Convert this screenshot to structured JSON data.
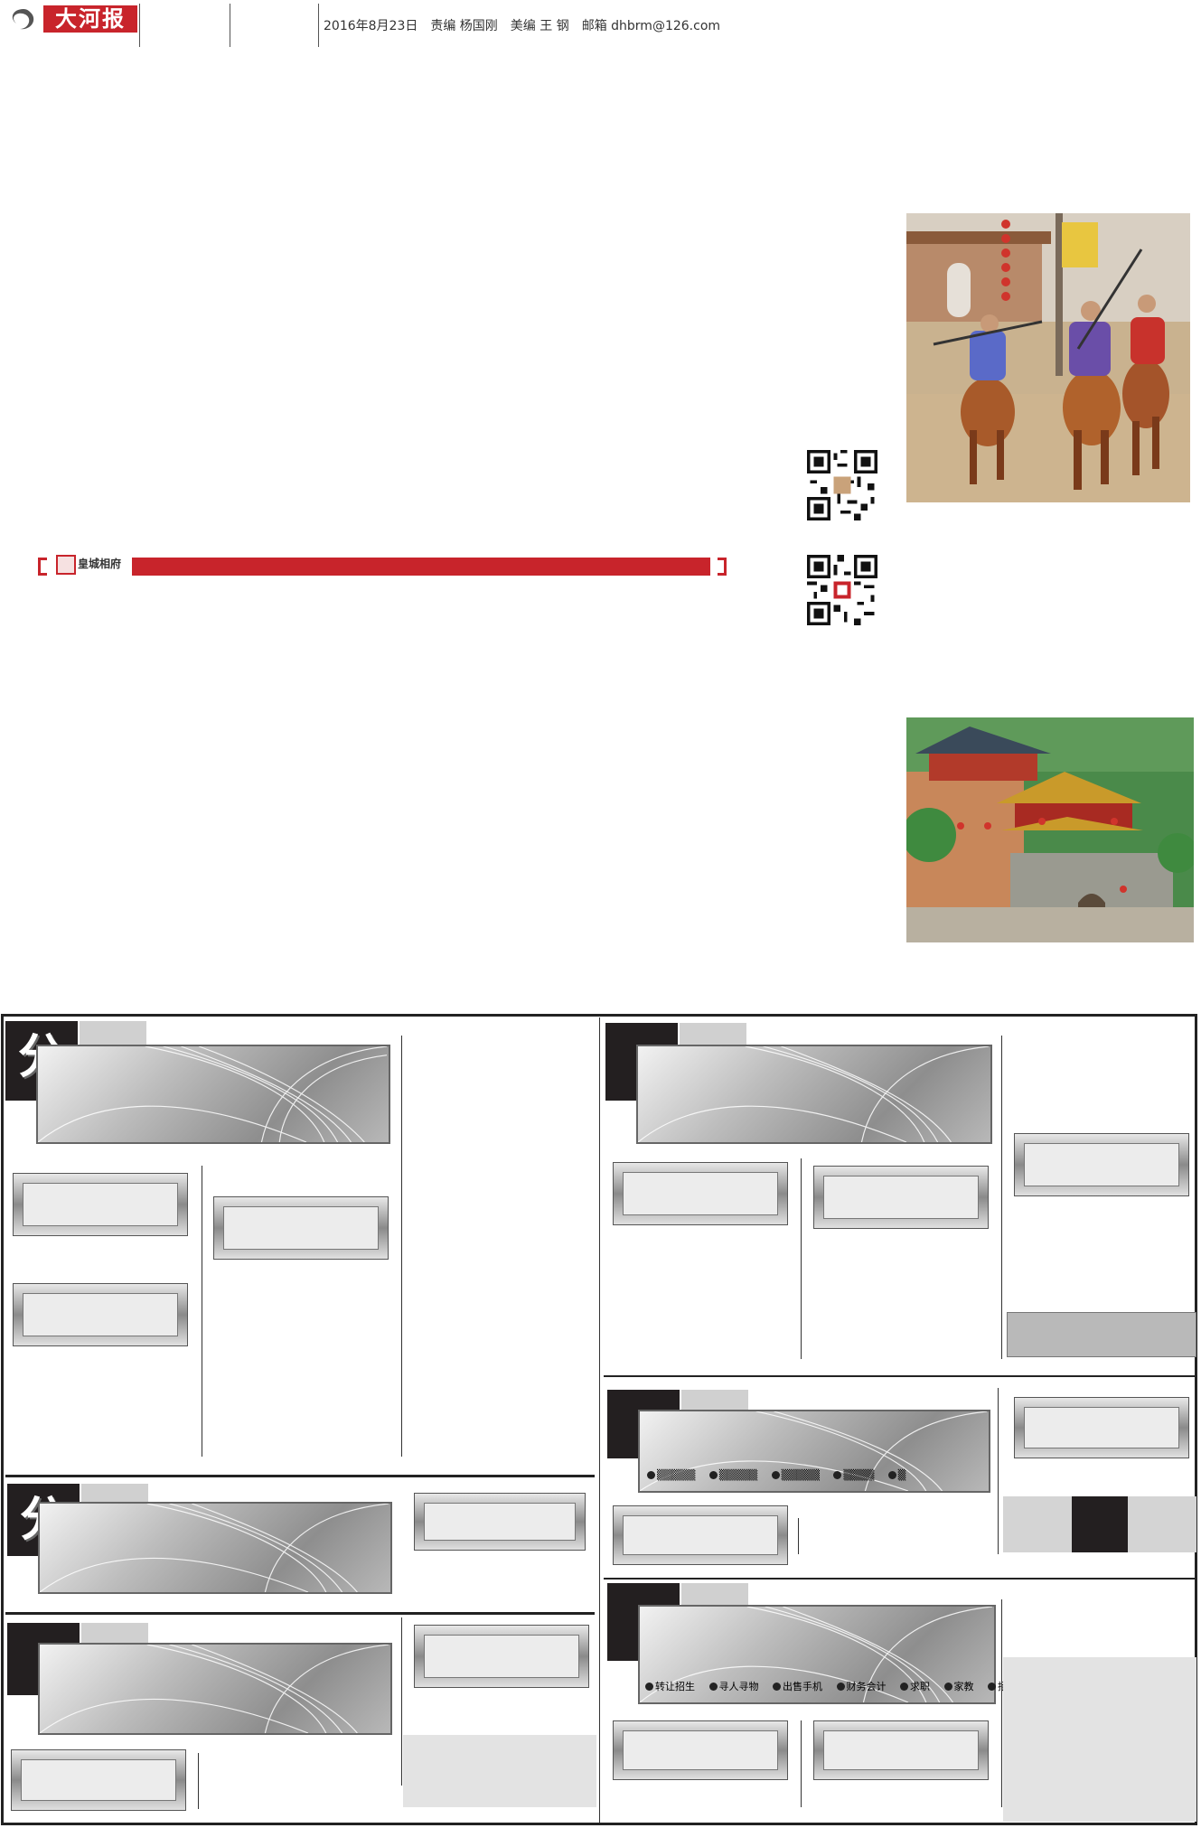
{
  "header": {
    "logo_text": "大河报",
    "info": "2016年8月23日　责编 杨国刚　美编 王 钢　邮箱 dhbrm@126.com"
  },
  "photos": {
    "top": {
      "alt": "horsemen-performance-photo"
    },
    "bottom": {
      "alt": "ancient-gate-tower-photo"
    }
  },
  "banner": {
    "logo_text": "皇城相府"
  },
  "classifieds": {
    "fen_label_1": "分",
    "fen_label_2": "分",
    "category_row_1": [
      "",
      "",
      "",
      "",
      ""
    ],
    "category_row_2": [
      "转让招生",
      "寻人寻物",
      "出售手机",
      "财务会计",
      "求职",
      "家教",
      "招聘"
    ]
  },
  "colors": {
    "brand_red": "#c8242b",
    "dark_tag": "#231f20",
    "light_tag": "#d0d0d0"
  }
}
